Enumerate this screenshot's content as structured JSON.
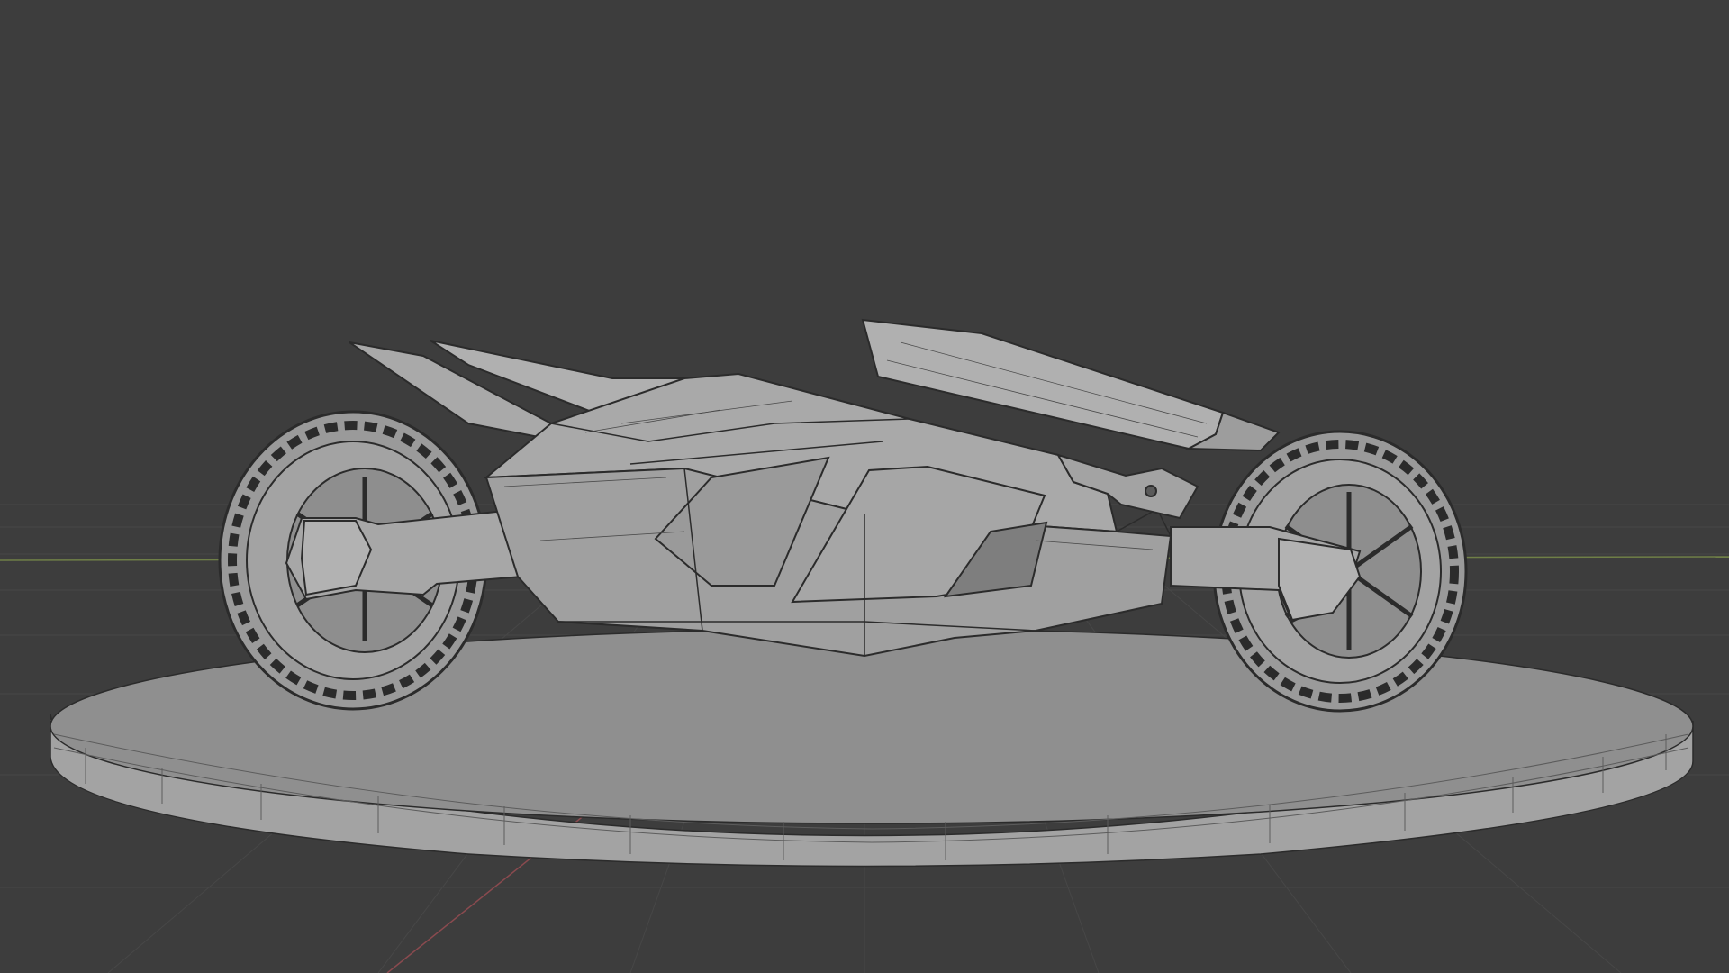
{
  "viewport": {
    "background_color": "#3d3d3d",
    "grid_line_color": "#474747",
    "x_axis_color": "#8a4a4f",
    "y_axis_color": "#6f7f47",
    "mode": "solid-with-wireframe"
  },
  "scene": {
    "model": "futuristic-motorcycle",
    "mesh_face_color": "#9c9c9c",
    "mesh_face_light_color": "#ababab",
    "mesh_face_dark_color": "#838383",
    "wire_color": "#2b2b2b",
    "pedestal_top_color": "#8f8f8f",
    "pedestal_side_color": "#a3a3a3"
  }
}
